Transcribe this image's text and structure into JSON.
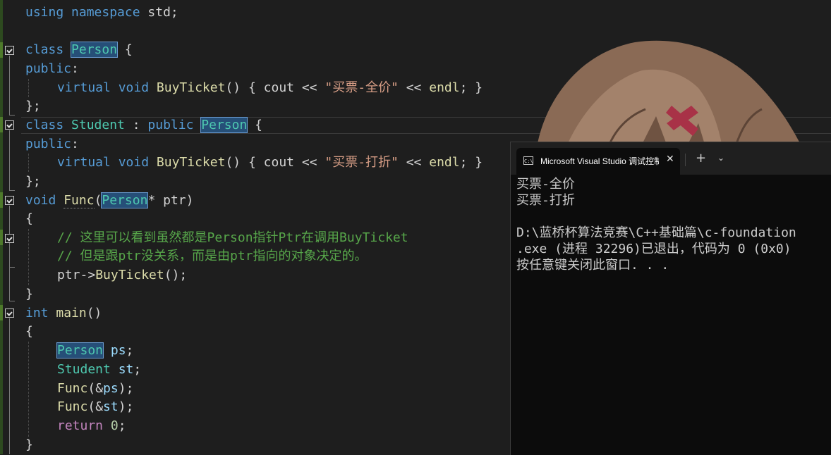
{
  "editor": {
    "lines": {
      "l1": {
        "using": "using",
        "namespace": "namespace",
        "std": "std;"
      },
      "l3": {
        "class": "class",
        "name": "Person",
        "brace": " {"
      },
      "l4": {
        "public": "public",
        "colon": ":"
      },
      "l5": {
        "virtual": "virtual",
        "void": "void",
        "fn": "BuyTicket",
        "p1": "() { ",
        "cout": "cout",
        "op": " << ",
        "str": "\"买票-全价\"",
        "op2": " << ",
        "endl": "endl",
        "tail": "; }"
      },
      "l6": {
        "text": "};"
      },
      "l7": {
        "class": "class",
        "name": "Student",
        "colon": " : ",
        "public": "public",
        "base": "Person",
        "brace": " {"
      },
      "l8": {
        "public": "public",
        "colon": ":"
      },
      "l9": {
        "virtual": "virtual",
        "void": "void",
        "fn": "BuyTicket",
        "p1": "() { ",
        "cout": "cout",
        "op": " << ",
        "str": "\"买票-打折\"",
        "op2": " << ",
        "endl": "endl",
        "tail": "; }"
      },
      "l10": {
        "text": "};"
      },
      "l11": {
        "void": "void",
        "fn": "Func",
        "p1": "(",
        "type": "Person",
        "p2": "* ptr)"
      },
      "l12": {
        "text": "{"
      },
      "l13": {
        "comment": "// 这里可以看到虽然都是Person指针Ptr在调用BuyTicket"
      },
      "l14": {
        "comment": "// 但是跟ptr没关系，而是由ptr指向的对象决定的。"
      },
      "l15": {
        "ptr": "ptr",
        "arrow": "->",
        "fn": "BuyTicket",
        "tail": "();"
      },
      "l16": {
        "text": "}"
      },
      "l17": {
        "int": "int",
        "fn": "main",
        "tail": "()"
      },
      "l18": {
        "text": "{"
      },
      "l19": {
        "type": "Person",
        "var": " ps",
        "tail": ";"
      },
      "l20": {
        "type": "Student",
        "var": " st",
        "tail": ";"
      },
      "l21": {
        "fn": "Func",
        "p1": "(&",
        "var": "ps",
        "tail": ");"
      },
      "l22": {
        "fn": "Func",
        "p1": "(&",
        "var": "st",
        "tail": ");"
      },
      "l23": {
        "kw": "return",
        "num": " 0",
        "tail": ";"
      },
      "l24": {
        "text": "}"
      }
    }
  },
  "terminal": {
    "tab_title": "Microsoft Visual Studio 调试控制台",
    "tab_icon": "C:\\",
    "close_glyph": "✕",
    "new_tab_glyph": "+",
    "dropdown_glyph": "⌄",
    "output": [
      "买票-全价",
      "买票-打折",
      "",
      "D:\\蓝桥杯算法竞赛\\C++基础篇\\c-foundation",
      ".exe (进程 32296)已退出，代码为 0 (0x0)",
      "按任意键关闭此窗口. . ."
    ]
  },
  "colors": {
    "editor_bg": "#1e1e1e",
    "keyword": "#569cd6",
    "type": "#4ec9b0",
    "function": "#dcdcaa",
    "string": "#d69d85",
    "comment": "#57a64a",
    "terminal_bg": "#0c0c0c"
  },
  "icons": [
    "fold-toggle-icon",
    "console-app-icon",
    "close-icon",
    "new-tab-icon",
    "chevron-down-icon"
  ]
}
